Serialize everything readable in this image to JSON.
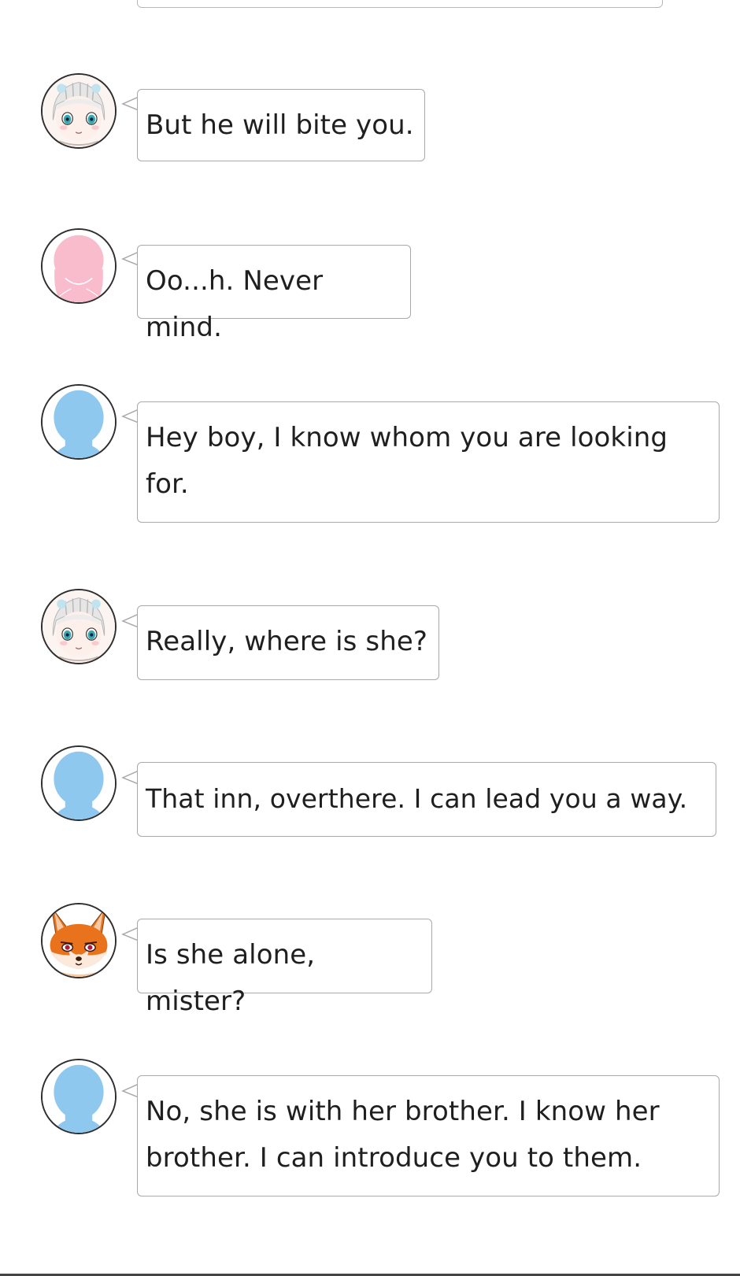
{
  "conversation": {
    "messages": [
      {
        "speaker": "white-haired-girl",
        "avatar_icon": "white-haired-girl-icon",
        "text": "But he will bite you."
      },
      {
        "speaker": "pink-silhouette",
        "avatar_icon": "pink-silhouette-icon",
        "text": "Oo...h. Never mind."
      },
      {
        "speaker": "blue-silhouette",
        "avatar_icon": "blue-silhouette-icon",
        "text": "Hey boy, I know whom you are looking for."
      },
      {
        "speaker": "white-haired-girl",
        "avatar_icon": "white-haired-girl-icon",
        "text": "Really, where is she?"
      },
      {
        "speaker": "blue-silhouette",
        "avatar_icon": "blue-silhouette-icon",
        "text": "That inn, overthere. I can lead you a way."
      },
      {
        "speaker": "fox",
        "avatar_icon": "fox-icon",
        "text": "Is she alone, mister?"
      },
      {
        "speaker": "blue-silhouette",
        "avatar_icon": "blue-silhouette-icon",
        "text": "No, she is with her brother. I know her brother. I can introduce you to them."
      }
    ]
  },
  "colors": {
    "bubble_border": "#a9a9a9",
    "avatar_border": "#2e2e2e",
    "pink_silhouette": "#f9bccd",
    "blue_silhouette": "#8ec8ef",
    "fox_orange": "#e8731c"
  }
}
